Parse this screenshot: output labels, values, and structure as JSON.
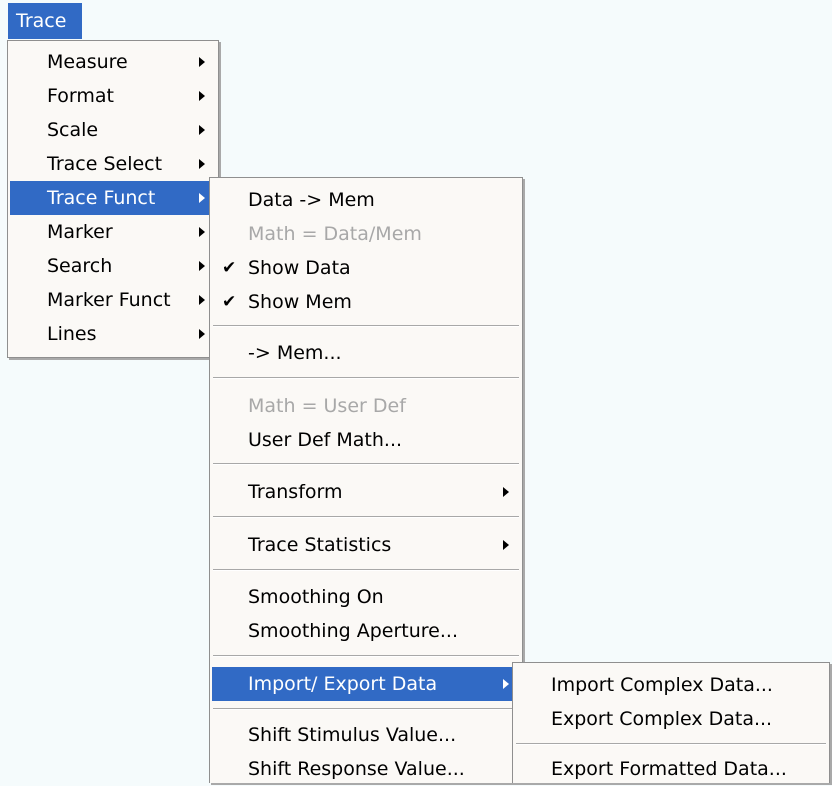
{
  "menu_title": "Trace",
  "trace_menu": [
    {
      "label": "Measure"
    },
    {
      "label": "Format"
    },
    {
      "label": "Scale"
    },
    {
      "label": "Trace Select"
    },
    {
      "label": "Trace Funct"
    },
    {
      "label": "Marker"
    },
    {
      "label": "Search"
    },
    {
      "label": "Marker Funct"
    },
    {
      "label": "Lines"
    }
  ],
  "trace_funct_menu": {
    "data_to_mem": "Data -> Mem",
    "math_data_mem": "Math = Data/Mem",
    "show_data": "Show Data",
    "show_mem": "Show Mem",
    "to_mem": "-> Mem...",
    "math_user_def": "Math = User Def",
    "user_def_math": "User Def Math...",
    "transform": "Transform",
    "trace_statistics": "Trace Statistics",
    "smoothing_on": "Smoothing On",
    "smoothing_aperture": "Smoothing Aperture...",
    "import_export_data": "Import/ Export Data",
    "shift_stimulus_value": "Shift Stimulus Value...",
    "shift_response_value": "Shift Response Value..."
  },
  "import_export_menu": {
    "import_complex": "Import Complex Data...",
    "export_complex": "Export Complex Data...",
    "export_formatted": "Export Formatted Data..."
  },
  "check_glyph": "✔"
}
